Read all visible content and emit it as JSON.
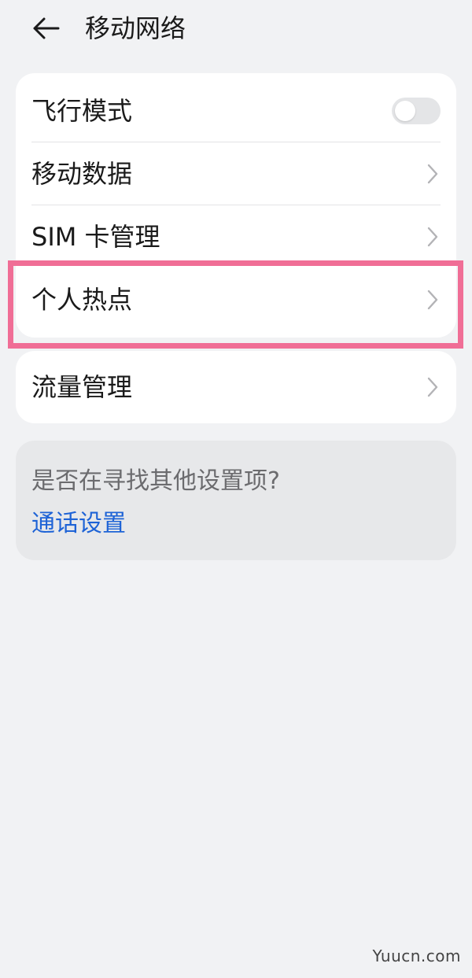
{
  "header": {
    "title": "移动网络",
    "back_icon": "arrow-left-icon"
  },
  "main_card": {
    "items": [
      {
        "label": "飞行模式",
        "control": "toggle",
        "toggle_on": false
      },
      {
        "label": "移动数据",
        "control": "chevron"
      },
      {
        "label": "SIM 卡管理",
        "control": "chevron"
      },
      {
        "label": "个人热点",
        "control": "chevron",
        "highlighted": true
      }
    ]
  },
  "flow_card": {
    "label": "流量管理",
    "control": "chevron"
  },
  "suggestion": {
    "title": "是否在寻找其他设置项?",
    "link": "通话设置"
  },
  "watermark": "Yuucn.com",
  "colors": {
    "background": "#f1f2f4",
    "card": "#ffffff",
    "highlight": "#f06e96",
    "link": "#1e63d6",
    "toggle_off": "#e4e5e7"
  }
}
